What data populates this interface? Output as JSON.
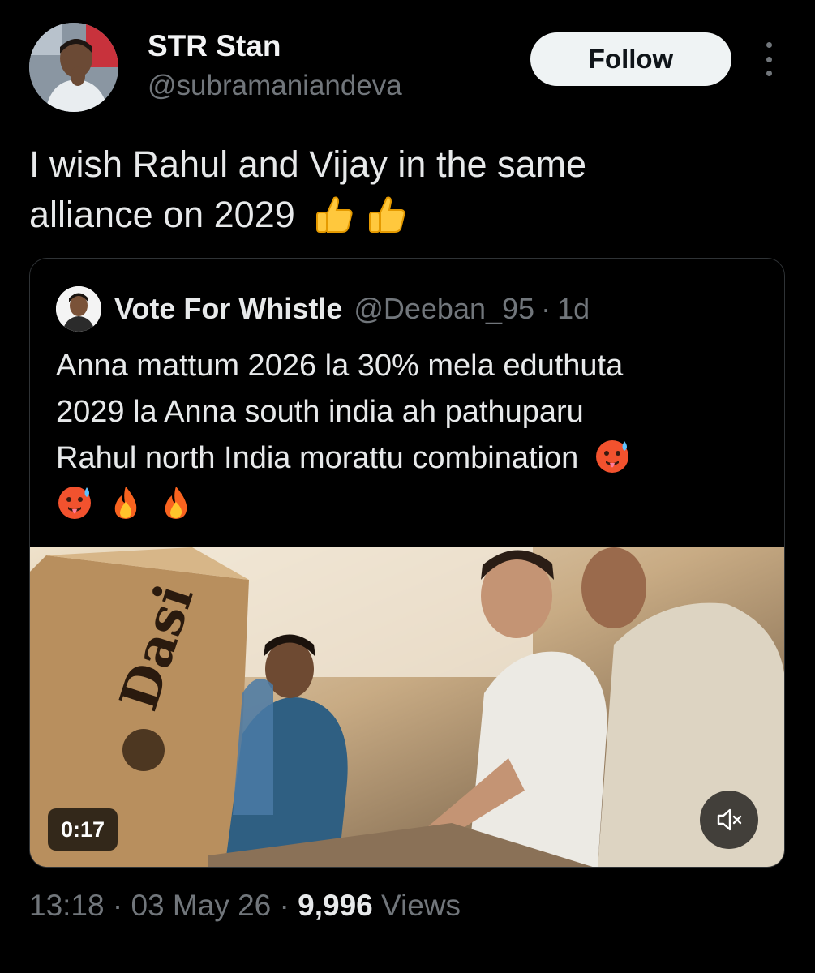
{
  "author": {
    "display_name": "STR Stan",
    "handle": "@subramaniandeva",
    "avatar_icon": "profile-photo"
  },
  "actions": {
    "follow_label": "Follow",
    "more_icon": "vertical-ellipsis-icon"
  },
  "tweet": {
    "line1": "I wish Rahul and Vijay in the same",
    "line2": "alliance on 2029",
    "emojis": [
      "thumbs-up",
      "thumbs-up"
    ]
  },
  "quoted": {
    "display_name": "Vote For Whistle",
    "handle": "@Deeban_95",
    "separator": "·",
    "time": "1d",
    "line1": "Anna mattum 2026 la 30% mela eduthuta",
    "line2": "2029 la Anna south india ah pathuparu",
    "line3": "Rahul north India morattu combination",
    "emojis": [
      "hot-face",
      "hot-face",
      "fire",
      "fire"
    ],
    "video": {
      "duration": "0:17",
      "box_text": "Dasi",
      "mute_icon": "speaker-muted-icon"
    }
  },
  "meta": {
    "time": "13:18",
    "sep1": "·",
    "date": "03 May 26",
    "sep2": "·",
    "views_count": "9,996",
    "views_label": "Views"
  },
  "colors": {
    "background": "#000000",
    "primary_text": "#e7e9ea",
    "secondary_text": "#71767b",
    "border": "#2f3336",
    "follow_button_bg": "#eff3f4"
  }
}
